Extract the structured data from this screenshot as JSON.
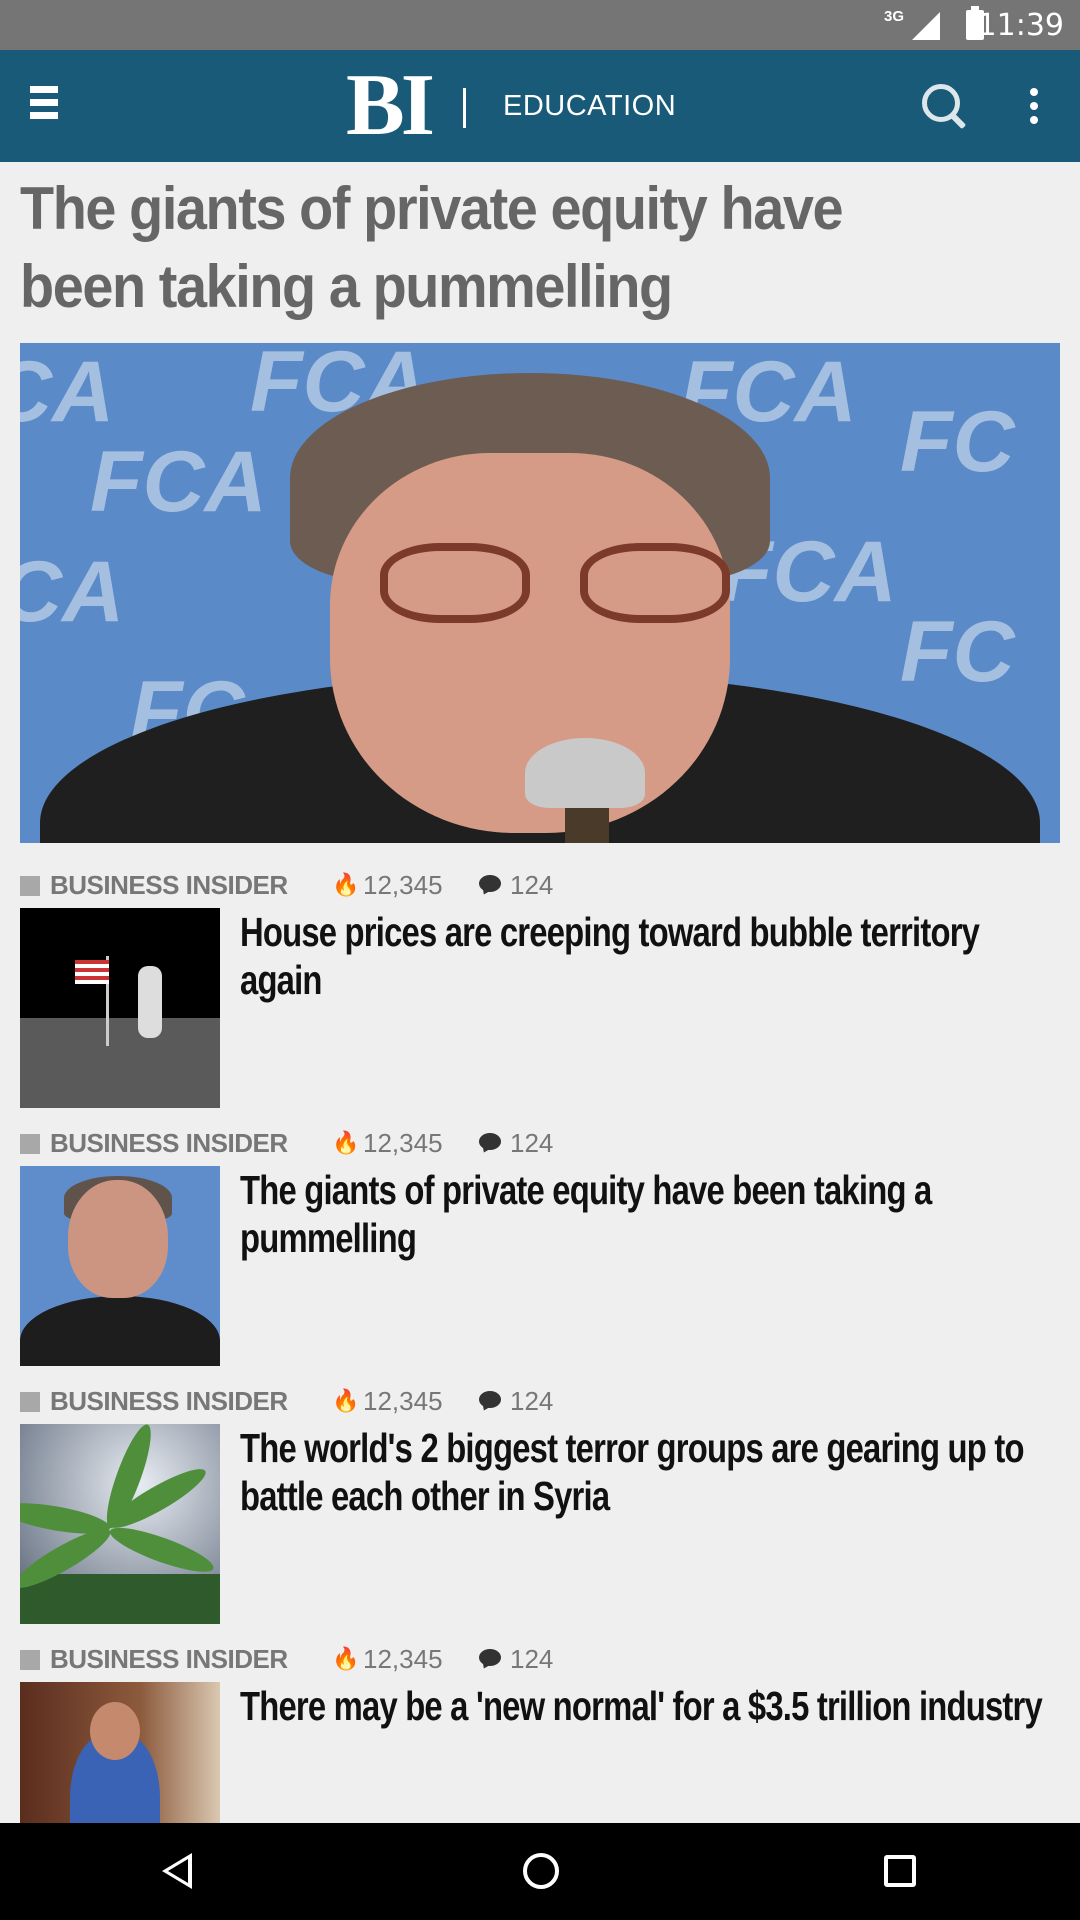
{
  "status_bar": {
    "network": "3G",
    "time": "11:39"
  },
  "app_bar": {
    "logo": "BI",
    "section": "EDUCATION"
  },
  "headline": "The giants of private equity have been taking a pummelling",
  "articles": [
    {
      "source": "BUSINESS INSIDER",
      "views": "12,345",
      "comments": "124",
      "title": "House prices are creeping toward bubble territory again"
    },
    {
      "source": "BUSINESS INSIDER",
      "views": "12,345",
      "comments": "124",
      "title": "The giants of private equity have been taking a pummelling"
    },
    {
      "source": "BUSINESS INSIDER",
      "views": "12,345",
      "comments": "124",
      "title": "The world's 2 biggest terror groups are gearing up to battle each other in Syria"
    },
    {
      "source": "BUSINESS INSIDER",
      "views": "12,345",
      "comments": "124",
      "title": "There may be a 'new normal' for a $3.5 trillion industry"
    }
  ],
  "colors": {
    "app_bar": "#185a78",
    "status_bar": "#757575",
    "background": "#efefef"
  }
}
